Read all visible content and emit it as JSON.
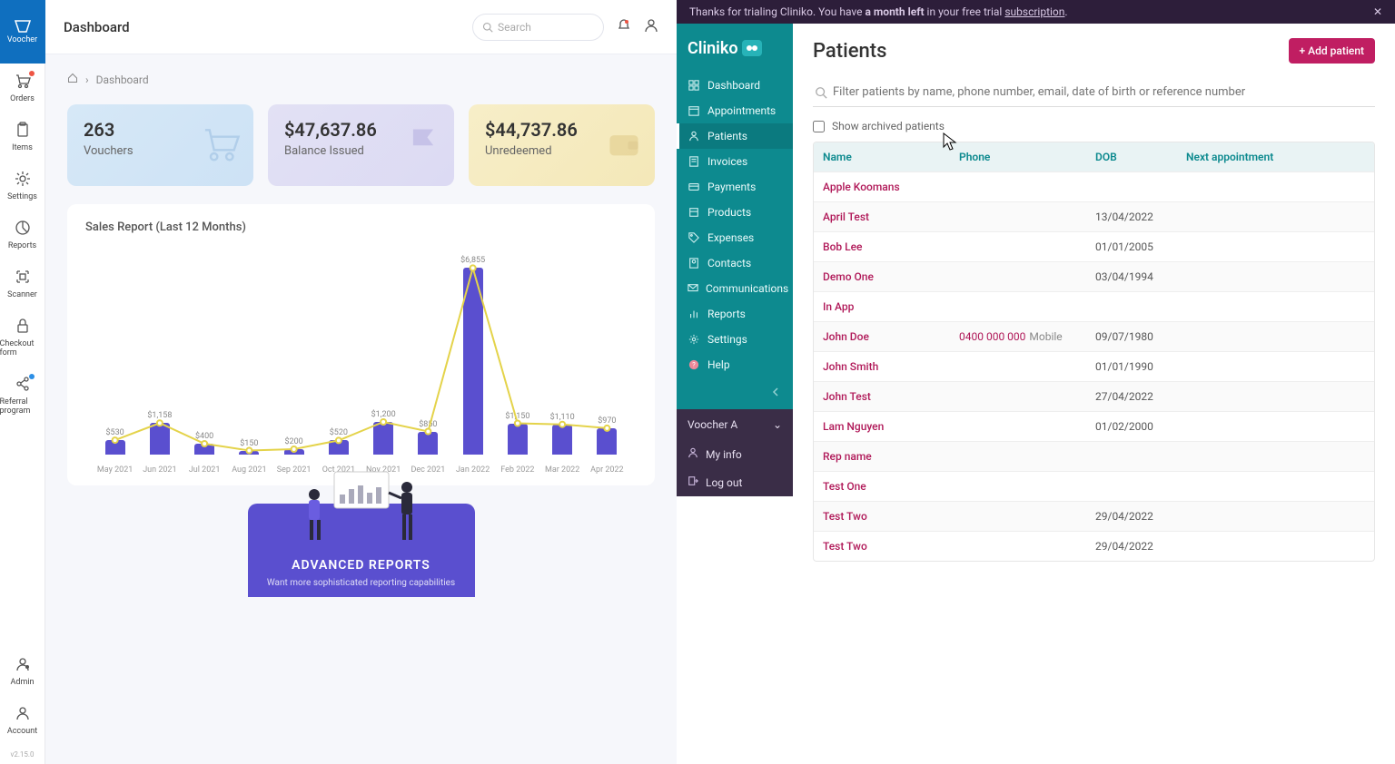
{
  "voocher": {
    "brand": "Voocher",
    "version": "v2.15.0",
    "nav": [
      {
        "label": "Orders",
        "icon": "cart",
        "dot": true
      },
      {
        "label": "Items",
        "icon": "clipboard"
      },
      {
        "label": "Settings",
        "icon": "gear"
      },
      {
        "label": "Reports",
        "icon": "chart"
      },
      {
        "label": "Scanner",
        "icon": "scan"
      },
      {
        "label": "Checkout form",
        "icon": "lock"
      },
      {
        "label": "Referral program",
        "icon": "share",
        "dot_blue": true
      }
    ],
    "nav_bottom": [
      {
        "label": "Admin",
        "icon": "admin"
      },
      {
        "label": "Account",
        "icon": "user"
      }
    ],
    "header": {
      "title": "Dashboard",
      "search_placeholder": "Search"
    },
    "breadcrumb_current": "Dashboard",
    "stats": [
      {
        "value": "263",
        "label": "Vouchers",
        "style": "blue",
        "icon": "cart"
      },
      {
        "value": "$47,637.86",
        "label": "Balance Issued",
        "style": "purple",
        "icon": "flag"
      },
      {
        "value": "$44,737.86",
        "label": "Unredeemed",
        "style": "yellow",
        "icon": "wallet"
      }
    ],
    "chart_title": "Sales Report (Last 12 Months)",
    "adv_reports": {
      "title": "ADVANCED REPORTS",
      "subtitle": "Want more sophisticated reporting capabilities"
    }
  },
  "chart_data": {
    "type": "bar",
    "title": "Sales Report (Last 12 Months)",
    "categories": [
      "May 2021",
      "Jun 2021",
      "Jul 2021",
      "Aug 2021",
      "Sep 2021",
      "Oct 2021",
      "Nov 2021",
      "Dec 2021",
      "Jan 2022",
      "Feb 2022",
      "Mar 2022",
      "Apr 2022"
    ],
    "values": [
      530,
      1158,
      400,
      150,
      200,
      520,
      1200,
      850,
      6855,
      1150,
      1110,
      970
    ],
    "value_labels": [
      "$530",
      "$1,158",
      "$400",
      "$150",
      "$200",
      "$520",
      "$1,200",
      "$850",
      "$6,855",
      "$1,150",
      "$1,110",
      "$970"
    ],
    "ylim": [
      0,
      7000
    ],
    "bar_color": "#5a4fcf",
    "line_color": "#e4d34a"
  },
  "cliniko": {
    "banner_prefix": "Thanks for trialing Cliniko. You have ",
    "banner_bold": "a month left",
    "banner_mid": " in your free trial ",
    "banner_link": "subscription",
    "banner_suffix": ".",
    "logo": "Cliniko",
    "nav": [
      {
        "label": "Dashboard",
        "icon": "grid"
      },
      {
        "label": "Appointments",
        "icon": "calendar"
      },
      {
        "label": "Patients",
        "icon": "person",
        "active": true
      },
      {
        "label": "Invoices",
        "icon": "invoice"
      },
      {
        "label": "Payments",
        "icon": "card"
      },
      {
        "label": "Products",
        "icon": "box"
      },
      {
        "label": "Expenses",
        "icon": "tag"
      },
      {
        "label": "Contacts",
        "icon": "contacts"
      },
      {
        "label": "Communications",
        "icon": "comm"
      },
      {
        "label": "Reports",
        "icon": "bar"
      },
      {
        "label": "Settings",
        "icon": "gear"
      },
      {
        "label": "Help",
        "icon": "help"
      }
    ],
    "account_name": "Voocher A",
    "account_items": [
      {
        "label": "My info",
        "icon": "user"
      },
      {
        "label": "Log out",
        "icon": "logout"
      }
    ],
    "page_title": "Patients",
    "add_button": "+ Add patient",
    "filter_placeholder": "Filter patients by name, phone number, email, date of birth or reference number",
    "archived_label": "Show archived patients",
    "table_headers": {
      "name": "Name",
      "phone": "Phone",
      "dob": "DOB",
      "next": "Next appointment"
    },
    "patients": [
      {
        "name": "Apple Koomans",
        "phone": "",
        "phone_type": "",
        "dob": ""
      },
      {
        "name": "April Test",
        "phone": "",
        "phone_type": "",
        "dob": "13/04/2022"
      },
      {
        "name": "Bob Lee",
        "phone": "",
        "phone_type": "",
        "dob": "01/01/2005"
      },
      {
        "name": "Demo One",
        "phone": "",
        "phone_type": "",
        "dob": "03/04/1994"
      },
      {
        "name": "In App",
        "phone": "",
        "phone_type": "",
        "dob": ""
      },
      {
        "name": "John Doe",
        "phone": "0400 000 000",
        "phone_type": "Mobile",
        "dob": "09/07/1980"
      },
      {
        "name": "John Smith",
        "phone": "",
        "phone_type": "",
        "dob": "01/01/1990"
      },
      {
        "name": "John Test",
        "phone": "",
        "phone_type": "",
        "dob": "27/04/2022"
      },
      {
        "name": "Lam Nguyen",
        "phone": "",
        "phone_type": "",
        "dob": "01/02/2000"
      },
      {
        "name": "Rep name",
        "phone": "",
        "phone_type": "",
        "dob": ""
      },
      {
        "name": "Test One",
        "phone": "",
        "phone_type": "",
        "dob": ""
      },
      {
        "name": "Test Two",
        "phone": "",
        "phone_type": "",
        "dob": "29/04/2022"
      },
      {
        "name": "Test Two",
        "phone": "",
        "phone_type": "",
        "dob": "29/04/2022"
      }
    ]
  }
}
